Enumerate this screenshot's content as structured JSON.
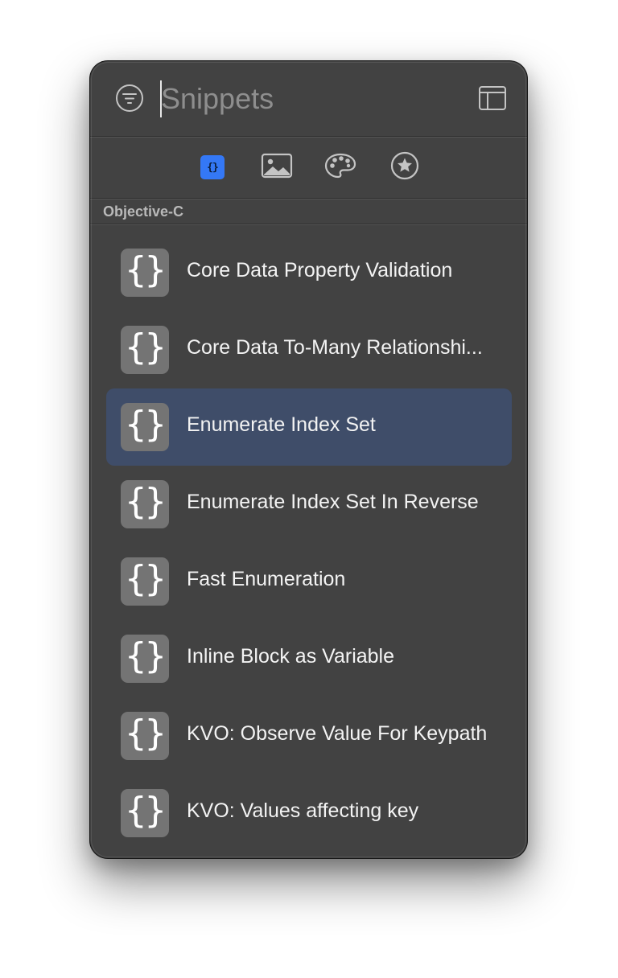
{
  "search": {
    "placeholder": "Snippets",
    "value": ""
  },
  "icons": {
    "filter": "filter-lines-icon",
    "layout": "sidebar-layout-icon"
  },
  "tabs": [
    {
      "name": "code-snippets",
      "icon": "curly-braces-icon",
      "glyph": "{}",
      "selected": true,
      "accent": "#3478f6"
    },
    {
      "name": "media",
      "icon": "image-icon",
      "selected": false
    },
    {
      "name": "colors",
      "icon": "palette-icon",
      "selected": false
    },
    {
      "name": "favorites",
      "icon": "star-icon",
      "selected": false
    }
  ],
  "section": {
    "label": "Objective-C"
  },
  "snippets": {
    "icon_glyph": "{}",
    "selected_index": 2,
    "items": [
      {
        "label": "Core Data Property Validation"
      },
      {
        "label": "Core Data To-Many Relationshi..."
      },
      {
        "label": "Enumerate Index Set"
      },
      {
        "label": "Enumerate Index Set In Reverse"
      },
      {
        "label": "Fast Enumeration"
      },
      {
        "label": "Inline Block as Variable"
      },
      {
        "label": "KVO: Observe Value For Keypath"
      },
      {
        "label": "KVO: Values affecting key"
      }
    ]
  },
  "colors": {
    "panel_bg": "#424242",
    "selection": "#3f4d69",
    "accent": "#3478f6",
    "icon_tile": "#747474"
  }
}
